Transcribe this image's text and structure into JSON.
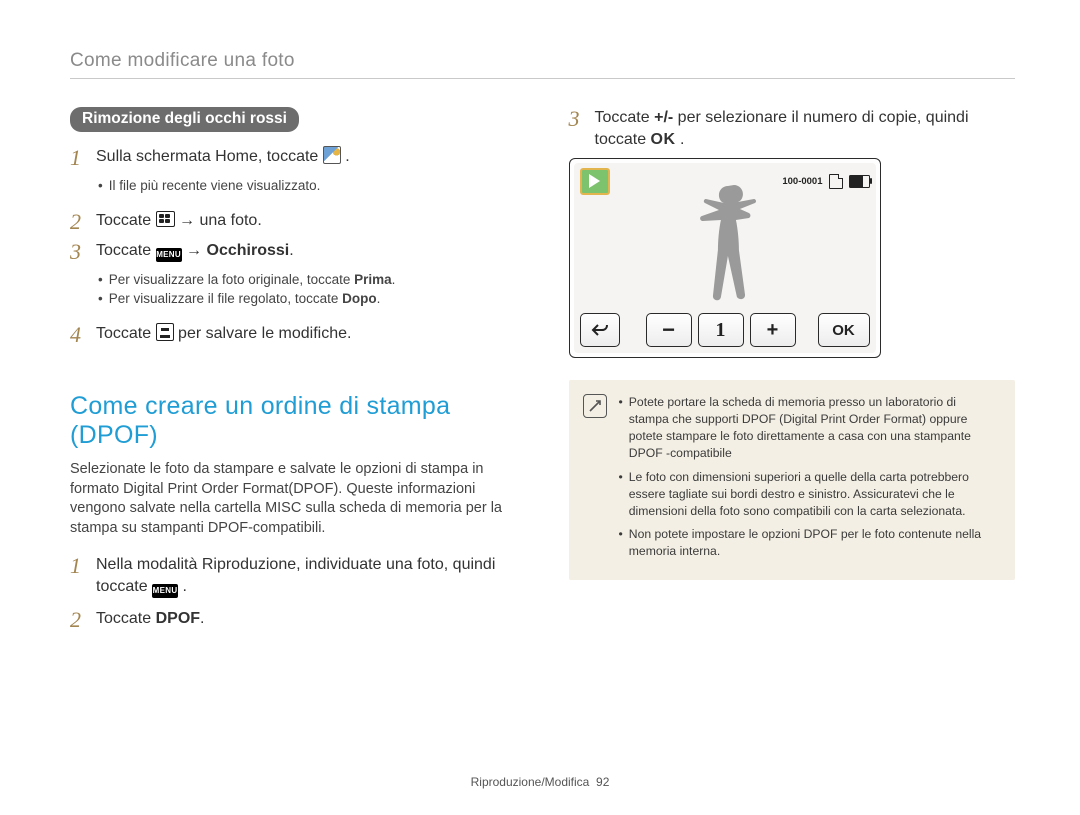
{
  "header": {
    "title": "Come modificare una foto"
  },
  "left": {
    "pill": "Rimozione degli occhi rossi",
    "steps": {
      "s1": {
        "num": "1",
        "pre": "Sulla schermata Home, toccate ",
        "post": "."
      },
      "s1_sub1": "Il file più recente viene visualizzato.",
      "s2": {
        "num": "2",
        "pre": "Toccate ",
        "mid": " → una foto."
      },
      "s3": {
        "num": "3",
        "pre": "Toccate ",
        "mid": " → ",
        "bold": "Occhirossi",
        "post": "."
      },
      "s3_sub1_pre": "Per visualizzare la foto originale, toccate ",
      "s3_sub1_bold": "Prima",
      "s3_sub2_pre": "Per visualizzare il file regolato, toccate ",
      "s3_sub2_bold": "Dopo",
      "s4": {
        "num": "4",
        "pre": "Toccate ",
        "post": " per salvare le modifiche."
      }
    },
    "h2": "Come creare un ordine di stampa (DPOF)",
    "para": "Selezionate le foto da stampare e salvate le opzioni di stampa in formato Digital Print Order Format(DPOF). Queste informazioni vengono salvate nella cartella MISC sulla scheda di memoria per la stampa su stampanti DPOF-compatibili.",
    "dpof": {
      "s1": {
        "num": "1",
        "pre": "Nella modalità Riproduzione, individuate una foto, quindi toccate ",
        "post": " ."
      },
      "s2": {
        "num": "2",
        "pre": "Toccate ",
        "bold": "DPOF",
        "post": "."
      }
    }
  },
  "right": {
    "s3": {
      "num": "3",
      "pre": "Toccate ",
      "plusminus": "+/-",
      "mid": " per selezionare il numero di copie, quindi toccate ",
      "post": " ."
    },
    "screen": {
      "file_id": "100-0001",
      "count": "1",
      "ok": "OK",
      "plus": "+",
      "minus": "−"
    },
    "note": {
      "items": [
        "Potete portare la scheda di memoria presso un laboratorio di stampa che supporti DPOF (Digital Print Order Format) oppure potete stampare le foto direttamente a casa con una stampante DPOF -compatibile",
        "Le foto con dimensioni superiori a quelle della carta potrebbero essere tagliate sui bordi destro e sinistro. Assicuratevi che le dimensioni della foto sono compatibili con la carta selezionata.",
        "Non potete impostare le opzioni DPOF per le foto contenute nella memoria interna."
      ]
    }
  },
  "footer": {
    "section": "Riproduzione/Modifica",
    "page": "92"
  },
  "glyphs": {
    "menu": "MENU",
    "ok": "OK",
    "arrow": "→"
  }
}
